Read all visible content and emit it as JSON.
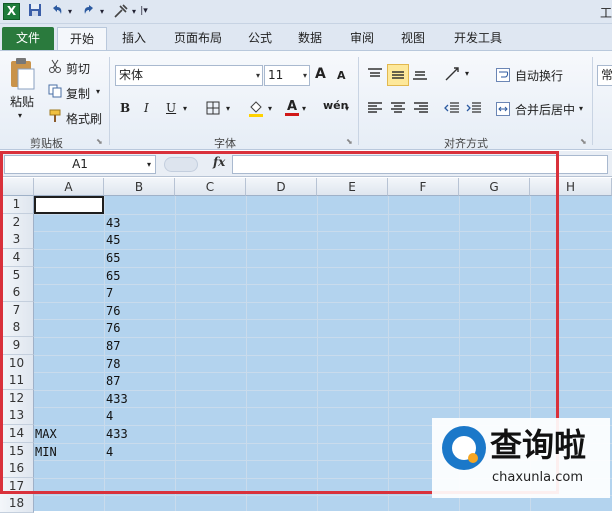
{
  "title_partial": "工",
  "qat": {
    "app_icon": "X",
    "save_icon": "save-icon",
    "undo_icon": "undo-icon",
    "redo_icon": "redo-icon",
    "customize_icon": "customize-icon"
  },
  "tabs": [
    "文件",
    "开始",
    "插入",
    "页面布局",
    "公式",
    "数据",
    "审阅",
    "视图",
    "开发工具"
  ],
  "ribbon": {
    "clipboard": {
      "paste": "粘贴",
      "cut": "剪切",
      "copy": "复制",
      "format_painter": "格式刷",
      "label": "剪贴板"
    },
    "font": {
      "name": "宋体",
      "size": "11",
      "bold": "B",
      "italic": "I",
      "underline": "U",
      "label": "字体",
      "grow": "A",
      "shrink": "A",
      "wen": "wén"
    },
    "alignment": {
      "wrap": "自动换行",
      "merge": "合并后居中",
      "label": "对齐方式"
    },
    "number_partial": "常"
  },
  "formula_bar": {
    "name_box": "A1",
    "fx": "fx",
    "content": ""
  },
  "grid": {
    "columns": [
      "A",
      "B",
      "C",
      "D",
      "E",
      "F",
      "G",
      "H"
    ],
    "rows": [
      "1",
      "2",
      "3",
      "4",
      "5",
      "6",
      "7",
      "8",
      "9",
      "10",
      "11",
      "12",
      "13",
      "14",
      "15",
      "16",
      "17",
      "18"
    ],
    "col_b_values": [
      "43",
      "45",
      "65",
      "65",
      "7",
      "76",
      "76",
      "87",
      "78",
      "87",
      "433",
      "4",
      "433",
      "4"
    ],
    "a14": "MAX",
    "a15": "MIN"
  },
  "watermark": {
    "text": "查询啦",
    "url": "chaxunla.com"
  }
}
